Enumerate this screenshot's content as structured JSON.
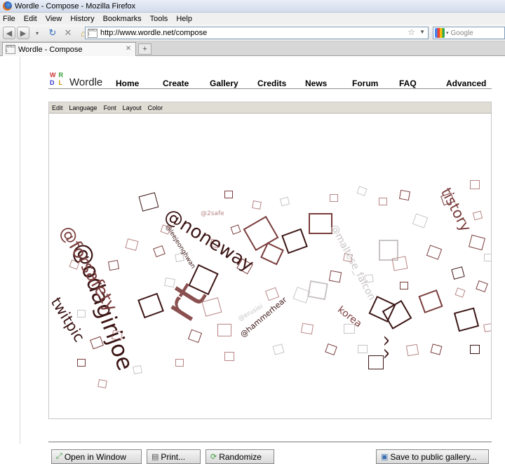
{
  "window": {
    "title": "Wordle - Compose - Mozilla Firefox",
    "menus": [
      "File",
      "Edit",
      "View",
      "History",
      "Bookmarks",
      "Tools",
      "Help"
    ]
  },
  "navigation": {
    "url": "http://www.wordle.net/compose",
    "search_placeholder": "Google"
  },
  "tabs": [
    {
      "label": "Wordle - Compose"
    }
  ],
  "site": {
    "logo_letters": [
      "W",
      "R",
      "D",
      "L"
    ],
    "name": "Wordle",
    "nav": [
      "Home",
      "Create",
      "Gallery",
      "Credits",
      "News",
      "Forum",
      "FAQ",
      "Advanced"
    ]
  },
  "applet": {
    "menu": [
      "Edit",
      "Language",
      "Font",
      "Layout",
      "Color"
    ],
    "cloud_words": [
      "@odagirijoe",
      "@forsafety",
      "twitpic",
      "@noneway",
      "rt",
      "@leejeonghwan",
      "@2safe",
      "@erusiei",
      "@hammerhear",
      "@maltese_falcon",
      "korea",
      "tistory",
      "^^"
    ],
    "buttons": {
      "open_window": "Open in Window",
      "print": "Print...",
      "randomize": "Randomize",
      "save_gallery": "Save to public gallery..."
    }
  },
  "colors": {
    "word_dark": "#3b1414",
    "word_brown": "#7a3c3c",
    "word_rose": "#b88585",
    "word_gray": "#c9c4c4"
  }
}
